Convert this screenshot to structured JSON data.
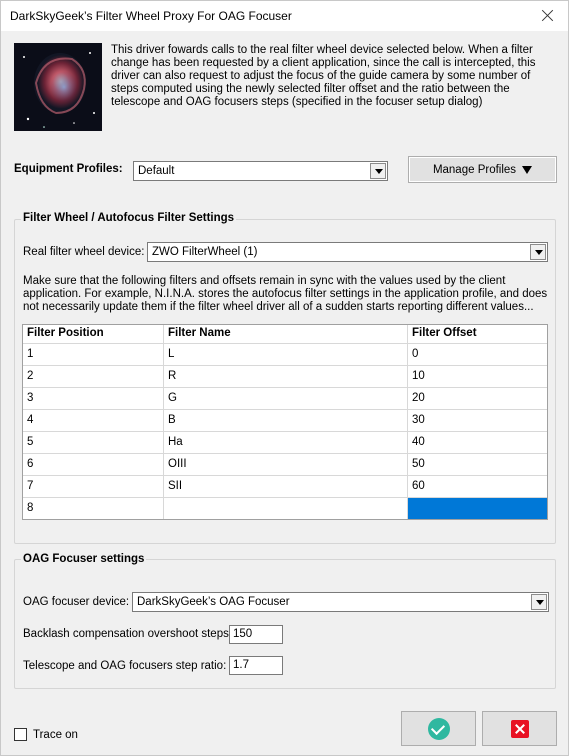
{
  "window": {
    "title": "DarkSkyGeek’s Filter Wheel Proxy For OAG Focuser"
  },
  "description": "This driver fowards calls to the real filter wheel device selected below. When a filter change has been requested by a client application, since the call is intercepted, this driver can also request to adjust the focus of the guide camera by some number of steps computed using the newly selected filter offset and the ratio between the telescope and OAG focusers steps (specified in the focuser setup dialog)",
  "equipment": {
    "label": "Equipment Profiles:",
    "value": "Default",
    "manage_label": "Manage Profiles"
  },
  "filter_group": {
    "title": "Filter Wheel / Autofocus Filter Settings",
    "device_label": "Real filter wheel device:",
    "device_value": "ZWO FilterWheel (1)",
    "note": "Make sure that the following filters and offsets remain in sync with the values used by the client application. For example, N.I.N.A. stores the autofocus filter settings in the application profile, and does not necessarily update them if the filter wheel driver all of a sudden starts reporting different values...",
    "columns": [
      "Filter Position",
      "Filter Name",
      "Filter Offset"
    ],
    "rows": [
      [
        "1",
        "L",
        "0"
      ],
      [
        "2",
        "R",
        "10"
      ],
      [
        "3",
        "G",
        "20"
      ],
      [
        "4",
        "B",
        "30"
      ],
      [
        "5",
        "Ha",
        "40"
      ],
      [
        "6",
        "OIII",
        "50"
      ],
      [
        "7",
        "SII",
        "60"
      ],
      [
        "8",
        "",
        ""
      ]
    ]
  },
  "oag_group": {
    "title": "OAG Focuser settings",
    "device_label": "OAG focuser device:",
    "device_value": "DarkSkyGeek’s OAG Focuser",
    "backlash_label": "Backlash compensation overshoot steps:",
    "backlash_value": "150",
    "ratio_label": "Telescope and OAG focusers step ratio:",
    "ratio_value": "1.7"
  },
  "trace": {
    "label": "Trace on",
    "checked": false
  },
  "icons": {
    "ok": "check-circle-icon",
    "cancel": "close-square-icon",
    "accent_ok": "#2fb8a0",
    "accent_cancel": "#e81123",
    "selection": "#0078d7"
  }
}
